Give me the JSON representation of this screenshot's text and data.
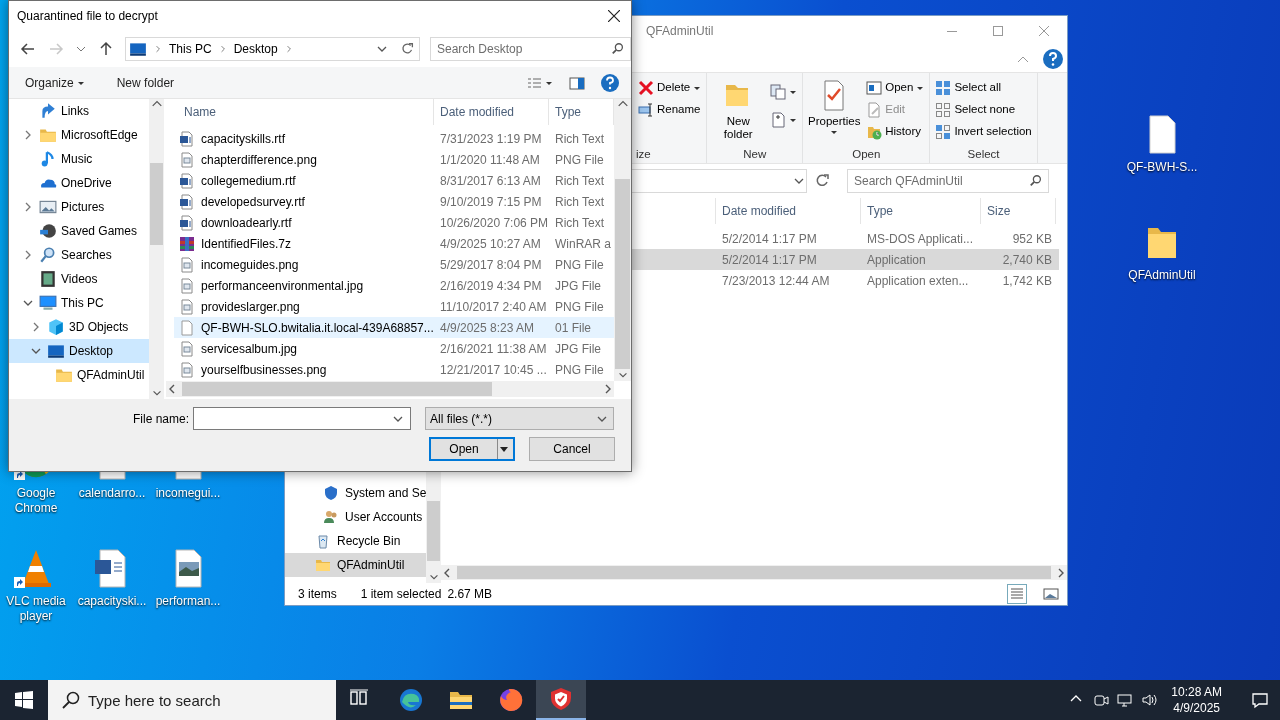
{
  "desktop_icons_left": [
    {
      "label": "Google Chrome",
      "kind": "chrome",
      "shortcut": true
    },
    {
      "label": "calendarro...",
      "kind": "document",
      "shortcut": false
    },
    {
      "label": "incomegui...",
      "kind": "image",
      "shortcut": false
    },
    {
      "label": "VLC media player",
      "kind": "vlc",
      "shortcut": true
    },
    {
      "label": "capacityski...",
      "kind": "document",
      "shortcut": false
    },
    {
      "label": "performan...",
      "kind": "image",
      "shortcut": false
    }
  ],
  "desktop_icons_right": [
    {
      "label": "QF-BWH-S...",
      "kind": "file",
      "shortcut": false
    },
    {
      "label": "QFAdminUtil",
      "kind": "folder",
      "shortcut": false
    }
  ],
  "explorer": {
    "title": "QFAdminUtil",
    "ribbon_groups": [
      {
        "label": "ize",
        "kind": "organize",
        "commands": [
          {
            "label": "Delete",
            "kind": "small",
            "dropdown": true,
            "disabled": false
          },
          {
            "label": "Rename",
            "kind": "small",
            "dropdown": false,
            "disabled": false
          }
        ]
      },
      {
        "label": "New",
        "kind": "new",
        "commands": [
          {
            "label": "New folder",
            "kind": "large",
            "dropdown": false,
            "disabled": false
          }
        ]
      },
      {
        "label": "Open",
        "kind": "open",
        "commands": [
          {
            "label": "Properties",
            "kind": "large",
            "dropdown": true,
            "disabled": false
          },
          {
            "label": "Open",
            "kind": "small",
            "dropdown": true,
            "disabled": false
          },
          {
            "label": "Edit",
            "kind": "small",
            "dropdown": false,
            "disabled": true
          },
          {
            "label": "History",
            "kind": "small",
            "dropdown": false,
            "disabled": false
          }
        ]
      },
      {
        "label": "Select",
        "kind": "select",
        "commands": [
          {
            "label": "Select all",
            "kind": "small",
            "dropdown": false,
            "disabled": false
          },
          {
            "label": "Select none",
            "kind": "small",
            "dropdown": false,
            "disabled": false
          },
          {
            "label": "Invert selection",
            "kind": "small",
            "dropdown": false,
            "disabled": false
          }
        ]
      }
    ],
    "search": {
      "placeholder": "Search QFAdminUtil"
    },
    "columns": [
      "Date modified",
      "Type",
      "Size"
    ],
    "rows": [
      {
        "date": "5/2/2014 1:17 PM",
        "type": "MS-DOS Applicati...",
        "size": "952 KB",
        "selected": false
      },
      {
        "date": "5/2/2014 1:17 PM",
        "type": "Application",
        "size": "2,740 KB",
        "selected": true
      },
      {
        "date": "7/23/2013 12:44 AM",
        "type": "Application exten...",
        "size": "1,742 KB",
        "selected": false
      }
    ],
    "nav_items": [
      {
        "label": "System and Se",
        "kind": "shield",
        "selected": false
      },
      {
        "label": "User Accounts",
        "kind": "users",
        "selected": false
      },
      {
        "label": "Recycle Bin",
        "kind": "recycle",
        "selected": false
      },
      {
        "label": "QFAdminUtil",
        "kind": "folder",
        "selected": true
      }
    ],
    "status": {
      "count": "3 items",
      "selection": "1 item selected",
      "size": "2.67 MB"
    }
  },
  "dialog": {
    "title": "Quarantined file to decrypt",
    "breadcrumb": [
      "This PC",
      "Desktop"
    ],
    "search": {
      "placeholder": "Search Desktop"
    },
    "toolbar": [
      {
        "label": "Organize",
        "dropdown": true
      },
      {
        "label": "New folder",
        "dropdown": false
      }
    ],
    "nav_tree": [
      {
        "label": "Links",
        "kind": "link",
        "selected": false
      },
      {
        "label": "MicrosoftEdge",
        "kind": "folder",
        "expanded": false,
        "selected": false
      },
      {
        "label": "Music",
        "kind": "music",
        "selected": false
      },
      {
        "label": "OneDrive",
        "kind": "cloud",
        "selected": false
      },
      {
        "label": "Pictures",
        "kind": "pictures",
        "expanded": false,
        "selected": false
      },
      {
        "label": "Saved Games",
        "kind": "games",
        "selected": false
      },
      {
        "label": "Searches",
        "kind": "search",
        "expanded": false,
        "selected": false
      },
      {
        "label": "Videos",
        "kind": "videos",
        "selected": false
      },
      {
        "label": "This PC",
        "kind": "pc",
        "expanded": true,
        "selected": false,
        "children": [
          {
            "label": "3D Objects",
            "kind": "cube",
            "expanded": false,
            "selected": false
          },
          {
            "label": "Desktop",
            "kind": "desktop",
            "expanded": true,
            "selected": true,
            "children": [
              {
                "label": "QFAdminUtil",
                "kind": "folder",
                "selected": false
              }
            ]
          }
        ]
      }
    ],
    "columns": [
      "Name",
      "Date modified",
      "Type"
    ],
    "files": [
      {
        "name": "capacityskills.rtf",
        "date": "7/31/2023 1:19 PM",
        "type": "Rich Text",
        "kind": "document",
        "selected": false
      },
      {
        "name": "chapterdifference.png",
        "date": "1/1/2020 11:48 AM",
        "type": "PNG File",
        "kind": "image",
        "selected": false
      },
      {
        "name": "collegemedium.rtf",
        "date": "8/31/2017 6:13 AM",
        "type": "Rich Text",
        "kind": "document",
        "selected": false
      },
      {
        "name": "developedsurvey.rtf",
        "date": "9/10/2019 7:15 PM",
        "type": "Rich Text",
        "kind": "document",
        "selected": false
      },
      {
        "name": "downloadearly.rtf",
        "date": "10/26/2020 7:06 PM",
        "type": "Rich Text",
        "kind": "document",
        "selected": false
      },
      {
        "name": "IdentifiedFiles.7z",
        "date": "4/9/2025 10:27 AM",
        "type": "WinRAR a",
        "kind": "archive",
        "selected": false
      },
      {
        "name": "incomeguides.png",
        "date": "5/29/2017 8:04 PM",
        "type": "PNG File",
        "kind": "image",
        "selected": false
      },
      {
        "name": "performanceenvironmental.jpg",
        "date": "2/16/2019 4:34 PM",
        "type": "JPG File",
        "kind": "image",
        "selected": false
      },
      {
        "name": "provideslarger.png",
        "date": "11/10/2017 2:40 AM",
        "type": "PNG File",
        "kind": "image",
        "selected": false
      },
      {
        "name": "QF-BWH-SLO.bwitalia.it.local-439A68857...",
        "date": "4/9/2025 8:23 AM",
        "type": "01 File",
        "kind": "file",
        "selected": true
      },
      {
        "name": "servicesalbum.jpg",
        "date": "2/16/2021 11:38 AM",
        "type": "JPG File",
        "kind": "image",
        "selected": false
      },
      {
        "name": "yourselfbusinesses.png",
        "date": "12/21/2017 10:45 ...",
        "type": "PNG File",
        "kind": "image",
        "selected": false
      }
    ],
    "file_name_label": "File name:",
    "filter": "All files (*.*)",
    "buttons": [
      {
        "label": "Open",
        "kind": "split"
      },
      {
        "label": "Cancel",
        "kind": "plain"
      }
    ]
  },
  "taskbar": {
    "search": {
      "placeholder": "Type here to search"
    },
    "apps": [
      {
        "kind": "taskview",
        "active": false
      },
      {
        "kind": "edge",
        "active": false
      },
      {
        "kind": "explorer",
        "active": false
      },
      {
        "kind": "firefox",
        "active": false
      },
      {
        "kind": "shield",
        "active": true
      }
    ],
    "time": "10:28 AM",
    "date": "4/9/2025"
  }
}
